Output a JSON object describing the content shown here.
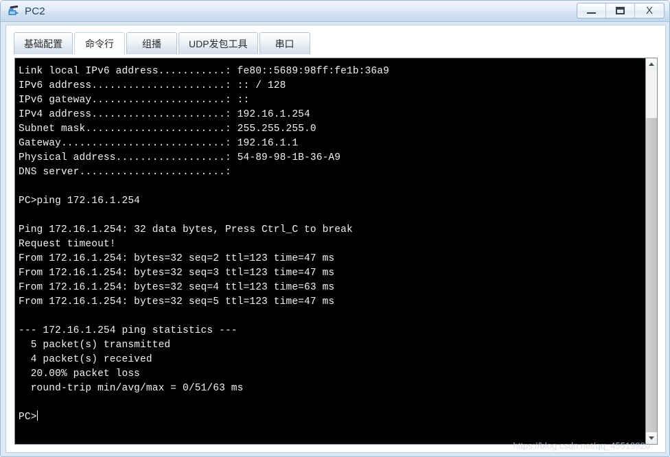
{
  "window": {
    "title": "PC2",
    "icon": "pc-device-icon",
    "buttons": {
      "minimize": "minimize-button",
      "maximize": "maximize-button",
      "close_label": "X"
    }
  },
  "tabs": [
    {
      "label": "基础配置",
      "active": false
    },
    {
      "label": "命令行",
      "active": true
    },
    {
      "label": "组播",
      "active": false
    },
    {
      "label": "UDP发包工具",
      "active": false
    },
    {
      "label": "串口",
      "active": false
    }
  ],
  "terminal": {
    "lines": [
      "Link local IPv6 address...........: fe80::5689:98ff:fe1b:36a9",
      "IPv6 address......................: :: / 128",
      "IPv6 gateway......................: ::",
      "IPv4 address......................: 192.16.1.254",
      "Subnet mask.......................: 255.255.255.0",
      "Gateway...........................: 192.16.1.1",
      "Physical address..................: 54-89-98-1B-36-A9",
      "DNS server........................:",
      "",
      "PC>ping 172.16.1.254",
      "",
      "Ping 172.16.1.254: 32 data bytes, Press Ctrl_C to break",
      "Request timeout!",
      "From 172.16.1.254: bytes=32 seq=2 ttl=123 time=47 ms",
      "From 172.16.1.254: bytes=32 seq=3 ttl=123 time=47 ms",
      "From 172.16.1.254: bytes=32 seq=4 ttl=123 time=63 ms",
      "From 172.16.1.254: bytes=32 seq=5 ttl=123 time=47 ms",
      "",
      "--- 172.16.1.254 ping statistics ---",
      "  5 packet(s) transmitted",
      "  4 packet(s) received",
      "  20.00% packet loss",
      "  round-trip min/avg/max = 0/51/63 ms",
      ""
    ],
    "prompt": "PC>",
    "colors": {
      "background": "#000000",
      "text": "#f2f2f2"
    }
  },
  "scrollbar": {
    "up_icon": "chevron-up-icon",
    "down_icon": "chevron-down-icon"
  },
  "watermark": {
    "text": "https://blog.csdn.net/qq_45519920"
  }
}
